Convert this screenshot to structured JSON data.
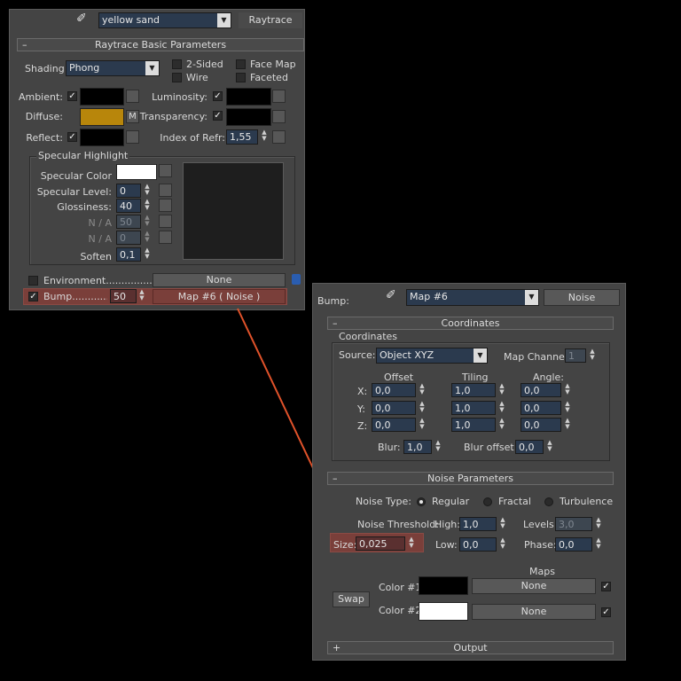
{
  "left": {
    "material_name": "yellow sand",
    "material_type": "Raytrace",
    "basic_rollout": "Raytrace Basic Parameters",
    "shading_label": "Shading:",
    "shading_value": "Phong",
    "two_sided": "2-Sided",
    "wire": "Wire",
    "face_map": "Face Map",
    "faceted": "Faceted",
    "ambient": "Ambient:",
    "diffuse": "Diffuse:",
    "reflect": "Reflect:",
    "luminosity": "Luminosity:",
    "transparency": "Transparency:",
    "ior_label": "Index of Refr:",
    "ior_value": "1,55",
    "m_label": "M",
    "spec_group": "Specular Highlight",
    "spec_color": "Specular Color",
    "spec_level": "Specular Level:",
    "spec_level_value": "0",
    "glossiness": "Glossiness:",
    "glossiness_value": "40",
    "na1": "N / A",
    "na1_value": "50",
    "na2": "N / A",
    "na2_value": "0",
    "soften": "Soften",
    "soften_value": "0,1",
    "environment": "Environment....................",
    "environment_map": "None",
    "bump": "Bump...............",
    "bump_value": "50",
    "bump_map": "Map #6  ( Noise )"
  },
  "right": {
    "bump_label": "Bump:",
    "map_name": "Map #6",
    "map_type": "Noise",
    "coord_rollout": "Coordinates",
    "coord_group": "Coordinates",
    "source_label": "Source:",
    "source_value": "Object XYZ",
    "map_channel_label": "Map Channel:",
    "map_channel_value": "1",
    "offset": "Offset",
    "tiling": "Tiling",
    "angle": "Angle:",
    "x": "X:",
    "y": "Y:",
    "z": "Z:",
    "x_offset": "0,0",
    "x_tiling": "1,0",
    "x_angle": "0,0",
    "y_offset": "0,0",
    "y_tiling": "1,0",
    "y_angle": "0,0",
    "z_offset": "0,0",
    "z_tiling": "1,0",
    "z_angle": "0,0",
    "blur_label": "Blur:",
    "blur_value": "1,0",
    "blur_offset_label": "Blur offset:",
    "blur_offset_value": "0,0",
    "noise_rollout": "Noise Parameters",
    "noise_type": "Noise Type:",
    "regular": "Regular",
    "fractal": "Fractal",
    "turbulence": "Turbulence",
    "threshold": "Noise Threshold:",
    "high_label": "High:",
    "high_value": "1,0",
    "levels_label": "Levels:",
    "levels_value": "3,0",
    "size_label": "Size:",
    "size_value": "0,025",
    "low_label": "Low:",
    "low_value": "0,0",
    "phase_label": "Phase:",
    "phase_value": "0,0",
    "maps_label": "Maps",
    "swap": "Swap",
    "color1": "Color #1",
    "color2": "Color #2",
    "color1_map": "None",
    "color2_map": "None",
    "output_rollout": "Output"
  },
  "colors": {
    "diffuse": "#b8860b",
    "arrow": "#e0522a",
    "highlight": "#7a3f3a"
  }
}
